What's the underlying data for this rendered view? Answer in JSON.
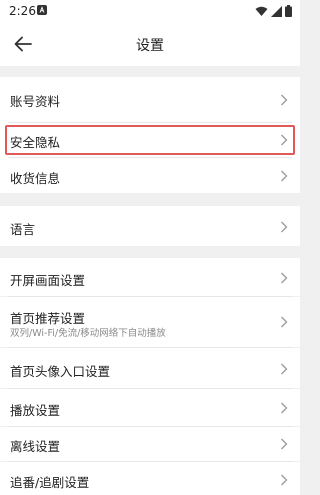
{
  "status": {
    "time": "2:26",
    "icons": [
      "notification-a-icon",
      "wifi-icon",
      "cell-signal-icon",
      "battery-icon"
    ]
  },
  "header": {
    "title": "设置",
    "back_icon": "arrow-left-icon"
  },
  "sections": [
    {
      "items": [
        {
          "label": "账号资料"
        },
        {
          "label": "安全隐私",
          "highlighted": true
        },
        {
          "label": "收货信息"
        }
      ]
    },
    {
      "items": [
        {
          "label": "语言"
        }
      ]
    },
    {
      "items": [
        {
          "label": "开屏画面设置"
        },
        {
          "label": "首页推荐设置",
          "sub": "双列/Wi-Fi/免流/移动网络下自动播放"
        },
        {
          "label": "首页头像入口设置"
        },
        {
          "label": "播放设置"
        },
        {
          "label": "离线设置"
        },
        {
          "label": "追番/追剧设置"
        }
      ]
    }
  ],
  "colors": {
    "background": "#f0f0f0",
    "highlight_border": "#e15a5a"
  }
}
